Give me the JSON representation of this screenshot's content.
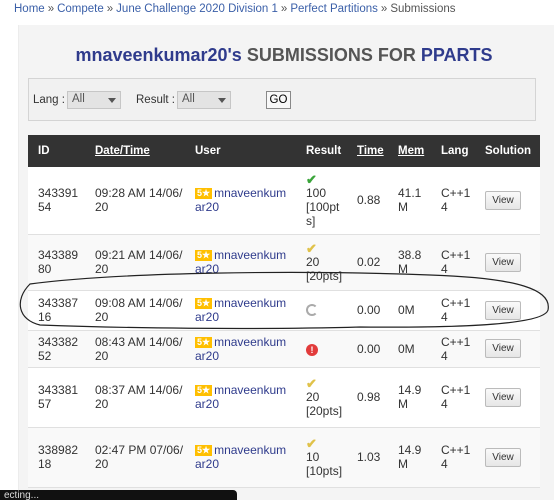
{
  "breadcrumb": {
    "home": "Home",
    "compete": "Compete",
    "contest": "June Challenge 2020 Division 1",
    "problem": "Perfect Partitions",
    "current": "Submissions",
    "separator": "»"
  },
  "title": {
    "username": "mnaveenkumar20's",
    "middle": "SUBMISSIONS FOR",
    "code": "PPARTS"
  },
  "filters": {
    "lang_label": "Lang :",
    "lang_value": "All",
    "result_label": "Result :",
    "result_value": "All",
    "go_label": "GO"
  },
  "table": {
    "headers": {
      "id": "ID",
      "datetime": "Date/Time",
      "user": "User",
      "result": "Result",
      "time": "Time",
      "mem": "Mem",
      "lang": "Lang",
      "solution": "Solution"
    },
    "rows": [
      {
        "id": "343391 54",
        "datetime": "09:28 AM 14/06/ 20",
        "stars": "5★",
        "user": "mnaveenkum ar20",
        "result_icon": "check-icon",
        "result": "100 [100pt s]",
        "time": "0.88",
        "mem": "41.1 M",
        "lang": "C++1 4",
        "view": "View"
      },
      {
        "id": "343389 80",
        "datetime": "09:21 AM 14/06/ 20",
        "stars": "5★",
        "user": "mnaveenkum ar20",
        "result_icon": "partial-check-icon",
        "result": "20 [20pts]",
        "time": "0.02",
        "mem": "38.8 M",
        "lang": "C++1 4",
        "view": "View"
      },
      {
        "id": "343387 16",
        "datetime": "09:08 AM 14/06/ 20",
        "stars": "5★",
        "user": "mnaveenkum ar20",
        "result_icon": "running-icon",
        "result": "",
        "time": "0.00",
        "mem": "0M",
        "lang": "C++1 4",
        "view": "View"
      },
      {
        "id": "343382 52",
        "datetime": "08:43 AM 14/06/ 20",
        "stars": "5★",
        "user": "mnaveenkum ar20",
        "result_icon": "error-icon",
        "result": "",
        "time": "0.00",
        "mem": "0M",
        "lang": "C++1 4",
        "view": "View"
      },
      {
        "id": "343381 57",
        "datetime": "08:37 AM 14/06/ 20",
        "stars": "5★",
        "user": "mnaveenkum ar20",
        "result_icon": "partial-check-icon",
        "result": "20 [20pts]",
        "time": "0.98",
        "mem": "14.9 M",
        "lang": "C++1 4",
        "view": "View"
      },
      {
        "id": "338982 18",
        "datetime": "02:47 PM 07/06/ 20",
        "stars": "5★",
        "user": "mnaveenkum ar20",
        "result_icon": "partial-check-icon",
        "result": "10 [10pts]",
        "time": "1.03",
        "mem": "14.9 M",
        "lang": "C++1 4",
        "view": "View"
      }
    ]
  },
  "toast": {
    "text": "ecting..."
  },
  "colors": {
    "header_bg": "#333333",
    "accent": "#2f3b8c",
    "star": "#ffbf00",
    "ok": "#3aa53a",
    "partial": "#e0c24a",
    "error": "#e23b3b"
  }
}
